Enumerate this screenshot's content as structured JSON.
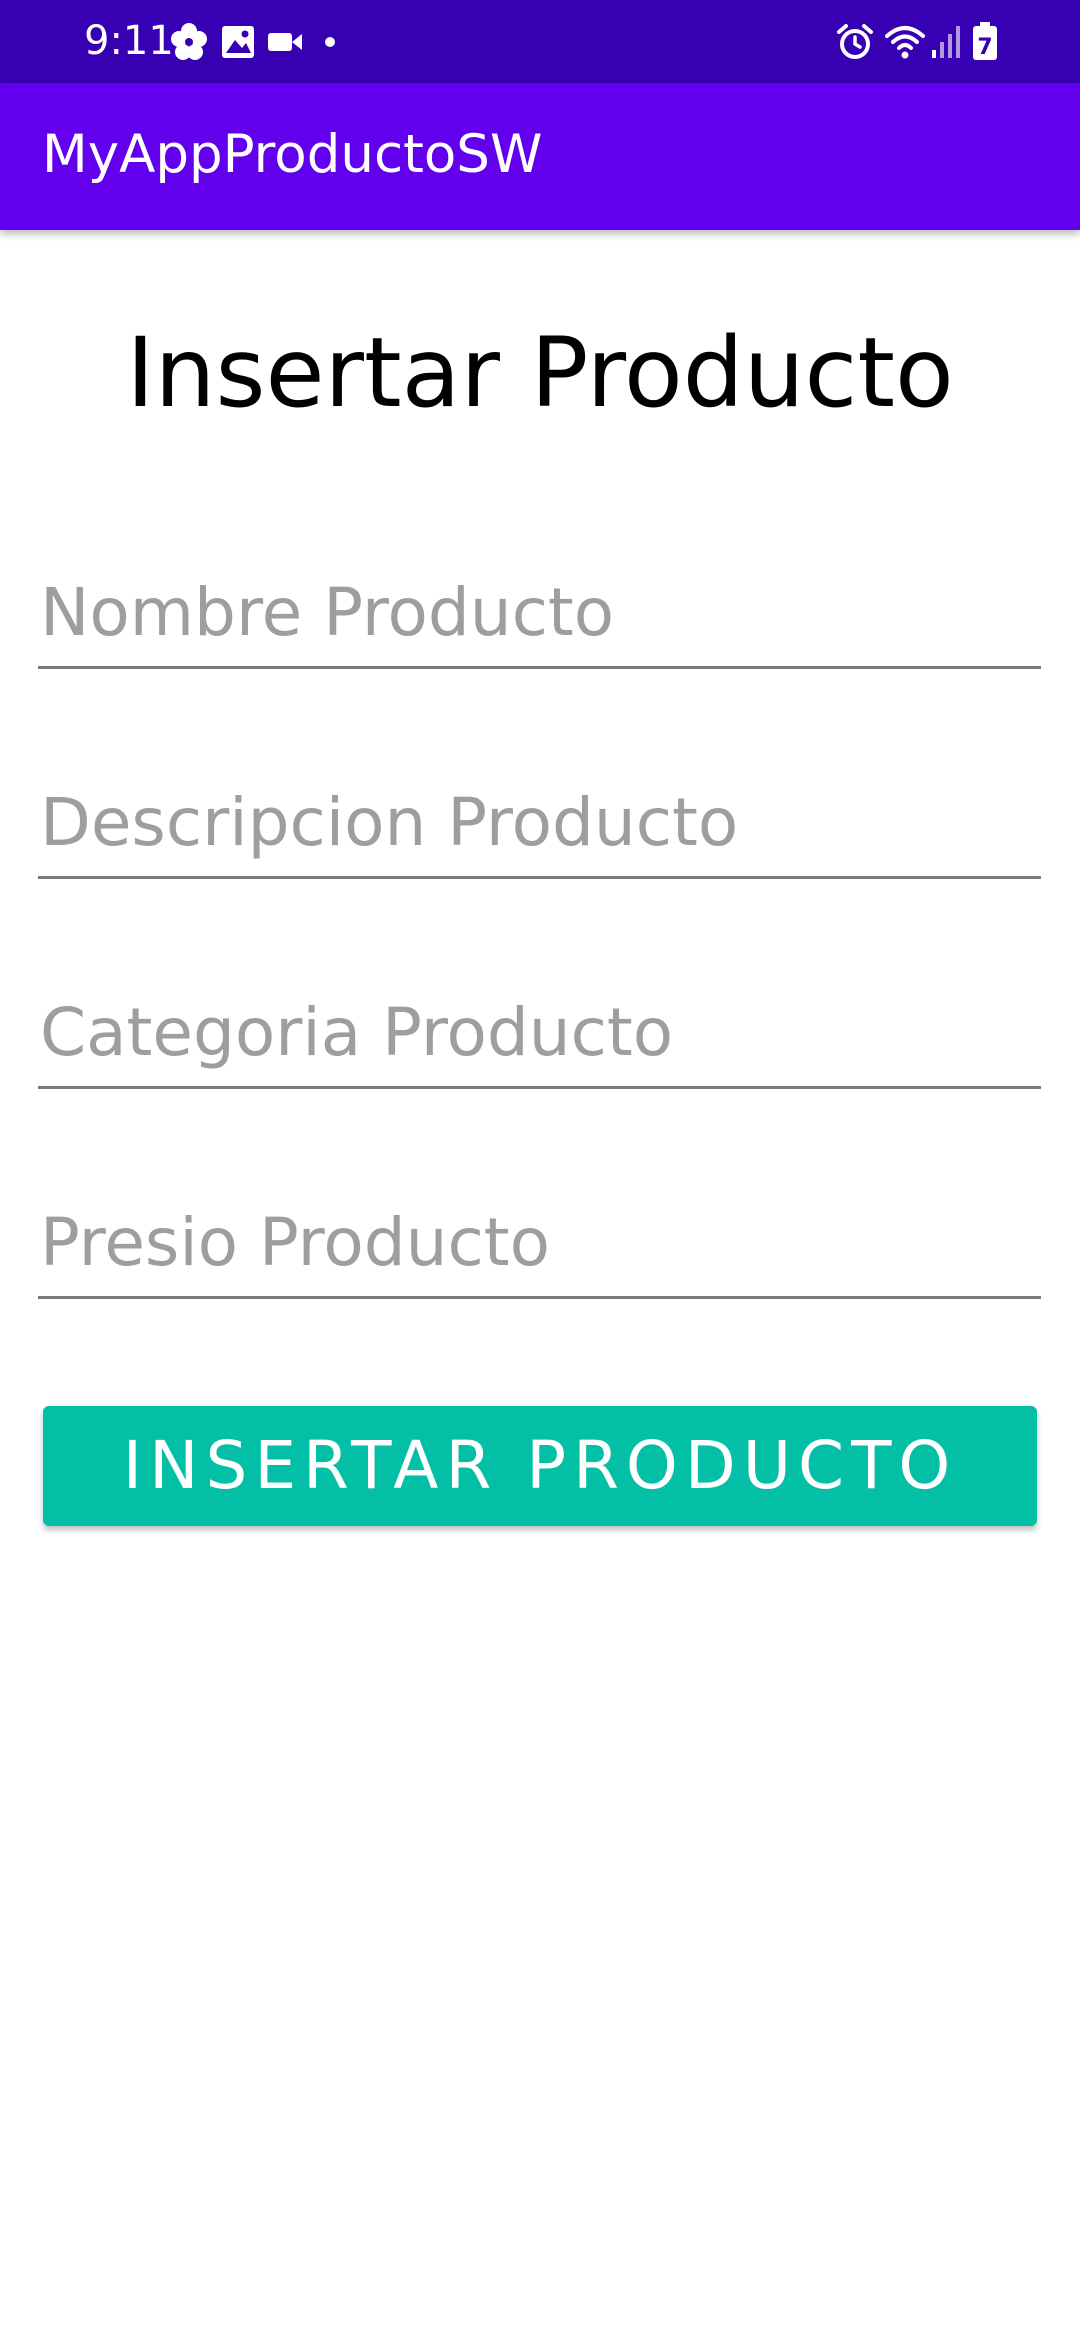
{
  "status_bar": {
    "time": "9:11",
    "left_icons": [
      "flower-notification-icon",
      "gallery-notification-icon",
      "video-notification-icon",
      "dot-notification-icon"
    ],
    "right_icons": [
      "alarm-icon",
      "wifi-icon",
      "signal-icon",
      "battery-icon"
    ],
    "battery_level": "7",
    "background_color": "#3700b3"
  },
  "app_bar": {
    "title": "MyAppProductoSW",
    "background_color": "#6200ee"
  },
  "form": {
    "heading": "Insertar Producto",
    "fields": [
      {
        "placeholder": "Nombre Producto",
        "value": ""
      },
      {
        "placeholder": "Descripcion Producto",
        "value": ""
      },
      {
        "placeholder": "Categoria Producto",
        "value": ""
      },
      {
        "placeholder": "Presio Producto",
        "value": ""
      }
    ],
    "submit_label": "INSERTAR PRODUCTO",
    "button_color": "#03bfa5"
  }
}
